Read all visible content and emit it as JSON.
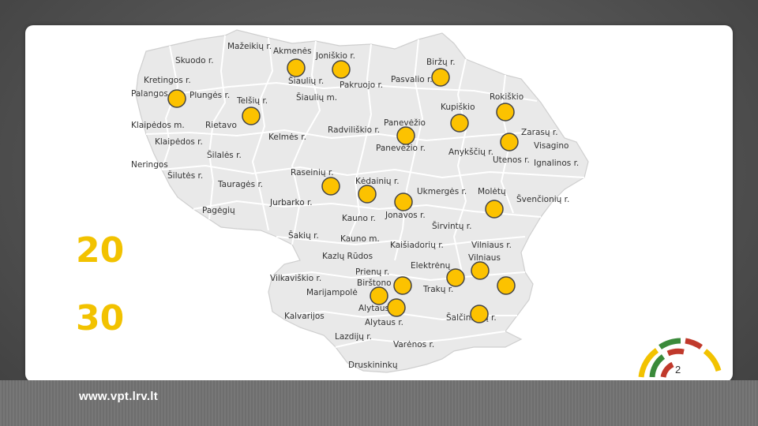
{
  "footer": {
    "url": "www.vpt.lrv.lt"
  },
  "year": {
    "line1": "20",
    "line2": "30"
  },
  "page_number": "2",
  "colors": {
    "marker_fill": "#fcc200",
    "marker_stroke": "#444444",
    "year_color": "#f2c200",
    "region_fill": "#e9e9e9",
    "border": "#ffffff"
  },
  "map": {
    "labels": [
      "Mažeikių r.",
      "Akmenės",
      "Skuodo r.",
      "Joniškio r.",
      "Biržų r.",
      "Kretingos r.",
      "Palangos",
      "Plungės r.",
      "Telšių r.",
      "Šiaulių r.",
      "Pakruojo r.",
      "Šiaulių m.",
      "Pasvalio r.",
      "Rokiškio",
      "Kupiškio",
      "Klaipėdos m.",
      "Rietavo",
      "Radviliškio r.",
      "Panevėžio",
      "Klaipėdos r.",
      "Kelmės r.",
      "Zarasų r.",
      "Visagino",
      "Šilalės r.",
      "Panevėžio r.",
      "Anykščių r.",
      "Utenos r.",
      "Neringos",
      "Ignalinos r.",
      "Šilutės r.",
      "Raseinių r.",
      "Kėdainių r.",
      "Tauragės r.",
      "Ukmergės r.",
      "Molėtų",
      "Švenčionių r.",
      "Jurbarko r.",
      "Pagėgių",
      "Kauno r.",
      "Jonavos r.",
      "Širvintų r.",
      "Šakių r.",
      "Kauno m.",
      "Kaišiadorių r.",
      "Vilniaus r.",
      "Vilniaus",
      "Kazlų Rūdos",
      "Elektrėnų",
      "Prienų r.",
      "Vilkaviškio r.",
      "Birštono",
      "Marijampolė",
      "Trakų r.",
      "Alytaus",
      "Kalvarijos",
      "Alytaus r.",
      "Šalčininkų r.",
      "Lazdijų r.",
      "Varėnos r.",
      "Druskininkų"
    ]
  }
}
